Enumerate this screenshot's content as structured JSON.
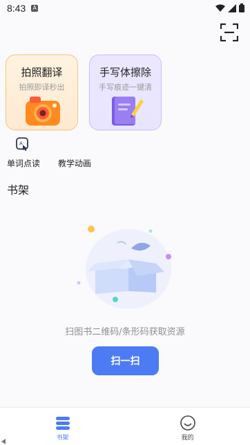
{
  "status_bar": {
    "time": "8:43",
    "notification_letter": "A"
  },
  "header": {
    "scan_icon": "scan-frame-icon"
  },
  "feature_cards": [
    {
      "title": "拍照翻译",
      "subtitle": "拍照即译秒出",
      "icon": "camera-icon",
      "accent": "#f6c27f"
    },
    {
      "title": "手写体擦除",
      "subtitle": "手写痕迹一键清",
      "icon": "notebook-pen-icon",
      "accent": "#c9bdf7"
    }
  ],
  "shortcuts": [
    {
      "label": "单词点读",
      "icon": "word-read-icon"
    },
    {
      "label": "教学动画"
    }
  ],
  "shelf": {
    "title": "书架",
    "empty_hint": "扫图书二维码/条形码获取资源",
    "scan_button": "扫一扫"
  },
  "tabs": [
    {
      "label": "书架",
      "icon": "bookshelf-icon",
      "active": true
    },
    {
      "label": "我的",
      "icon": "smiley-icon",
      "active": false
    }
  ],
  "colors": {
    "primary": "#4d7bf3",
    "background": "#fafafc"
  }
}
